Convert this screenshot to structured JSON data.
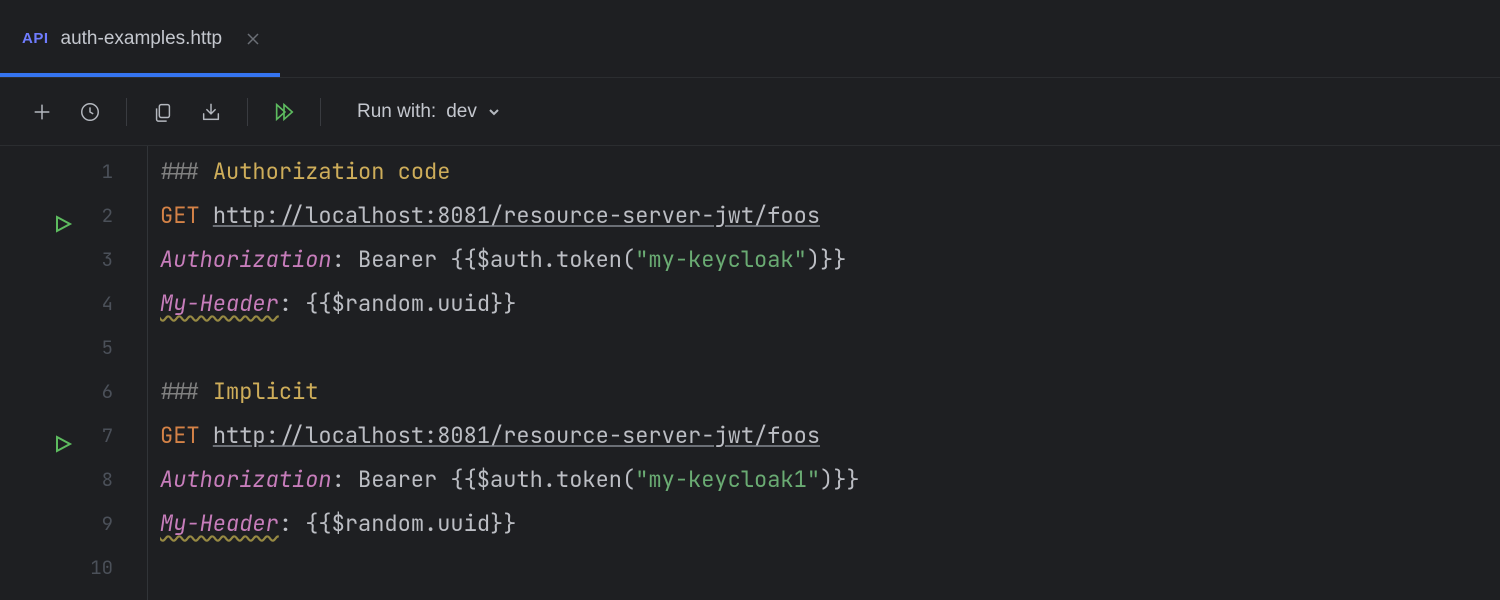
{
  "tab": {
    "icon_text": "API",
    "filename": "auth-examples.http"
  },
  "toolbar": {
    "run_with_label": "Run with:",
    "environment": "dev"
  },
  "editor": {
    "lines": [
      {
        "n": 1,
        "run": false,
        "tokens": [
          {
            "t": "### ",
            "cls": "c-gray"
          },
          {
            "t": "Authorization code",
            "cls": "c-olive"
          }
        ]
      },
      {
        "n": 2,
        "run": true,
        "tokens": [
          {
            "t": "GET ",
            "cls": "c-orange"
          },
          {
            "t": "http://localhost:8081/resource-server-jwt/foos",
            "cls": "c-url"
          }
        ]
      },
      {
        "n": 3,
        "run": false,
        "tokens": [
          {
            "t": "Authorization",
            "cls": "c-hdr"
          },
          {
            "t": ": Bearer {{$auth.token(",
            "cls": "c-plain"
          },
          {
            "t": "\"my-keycloak\"",
            "cls": "c-str"
          },
          {
            "t": ")}}",
            "cls": "c-plain"
          }
        ]
      },
      {
        "n": 4,
        "run": false,
        "tokens": [
          {
            "t": "My-Header",
            "cls": "c-hdr c-wavy"
          },
          {
            "t": ": {{$random.uuid}}",
            "cls": "c-plain"
          }
        ]
      },
      {
        "n": 5,
        "run": false,
        "tokens": []
      },
      {
        "n": 6,
        "run": false,
        "tokens": [
          {
            "t": "### ",
            "cls": "c-gray"
          },
          {
            "t": "Implicit",
            "cls": "c-olive"
          }
        ]
      },
      {
        "n": 7,
        "run": true,
        "tokens": [
          {
            "t": "GET ",
            "cls": "c-orange"
          },
          {
            "t": "http://localhost:8081/resource-server-jwt/foos",
            "cls": "c-url"
          }
        ]
      },
      {
        "n": 8,
        "run": false,
        "tokens": [
          {
            "t": "Authorization",
            "cls": "c-hdr"
          },
          {
            "t": ": Bearer {{$auth.token(",
            "cls": "c-plain"
          },
          {
            "t": "\"my-keycloak1\"",
            "cls": "c-str"
          },
          {
            "t": ")}}",
            "cls": "c-plain"
          }
        ]
      },
      {
        "n": 9,
        "run": false,
        "tokens": [
          {
            "t": "My-Header",
            "cls": "c-hdr c-wavy"
          },
          {
            "t": ": {{$random.uuid}}",
            "cls": "c-plain"
          }
        ]
      },
      {
        "n": 10,
        "run": false,
        "tokens": []
      }
    ]
  }
}
